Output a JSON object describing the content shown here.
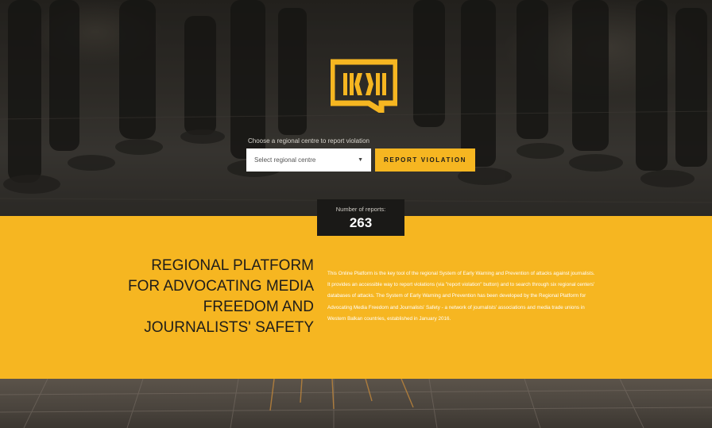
{
  "logo": {
    "icon": "ikm-logo-icon",
    "color": "#f6b621"
  },
  "report_form": {
    "label": "Choose a regional centre to report violation",
    "select_value": "Select regional centre",
    "button_label": "REPORT VIOLATION"
  },
  "counter": {
    "label": "Number of reports:",
    "value": "263"
  },
  "about": {
    "heading": "REGIONAL PLATFORM FOR ADVOCATING MEDIA FREEDOM AND JOURNALISTS' SAFETY",
    "body": "This Online Platform is the key tool of the regional System of Early Warning and Prevention of attacks against journalists. It provides an accessible way to report violations (via \"report violation\" button) and to search through six regional centers' databases of attacks. The System of Early Warning and Prevention has been developed by the Regional Platform for Advocating Media Freedom and Journalists' Safety - a network of journalists' associations and media trade unions in Western Balkan countries, established in January 2016."
  },
  "colors": {
    "accent": "#f6b621",
    "dark": "#1a1917"
  }
}
